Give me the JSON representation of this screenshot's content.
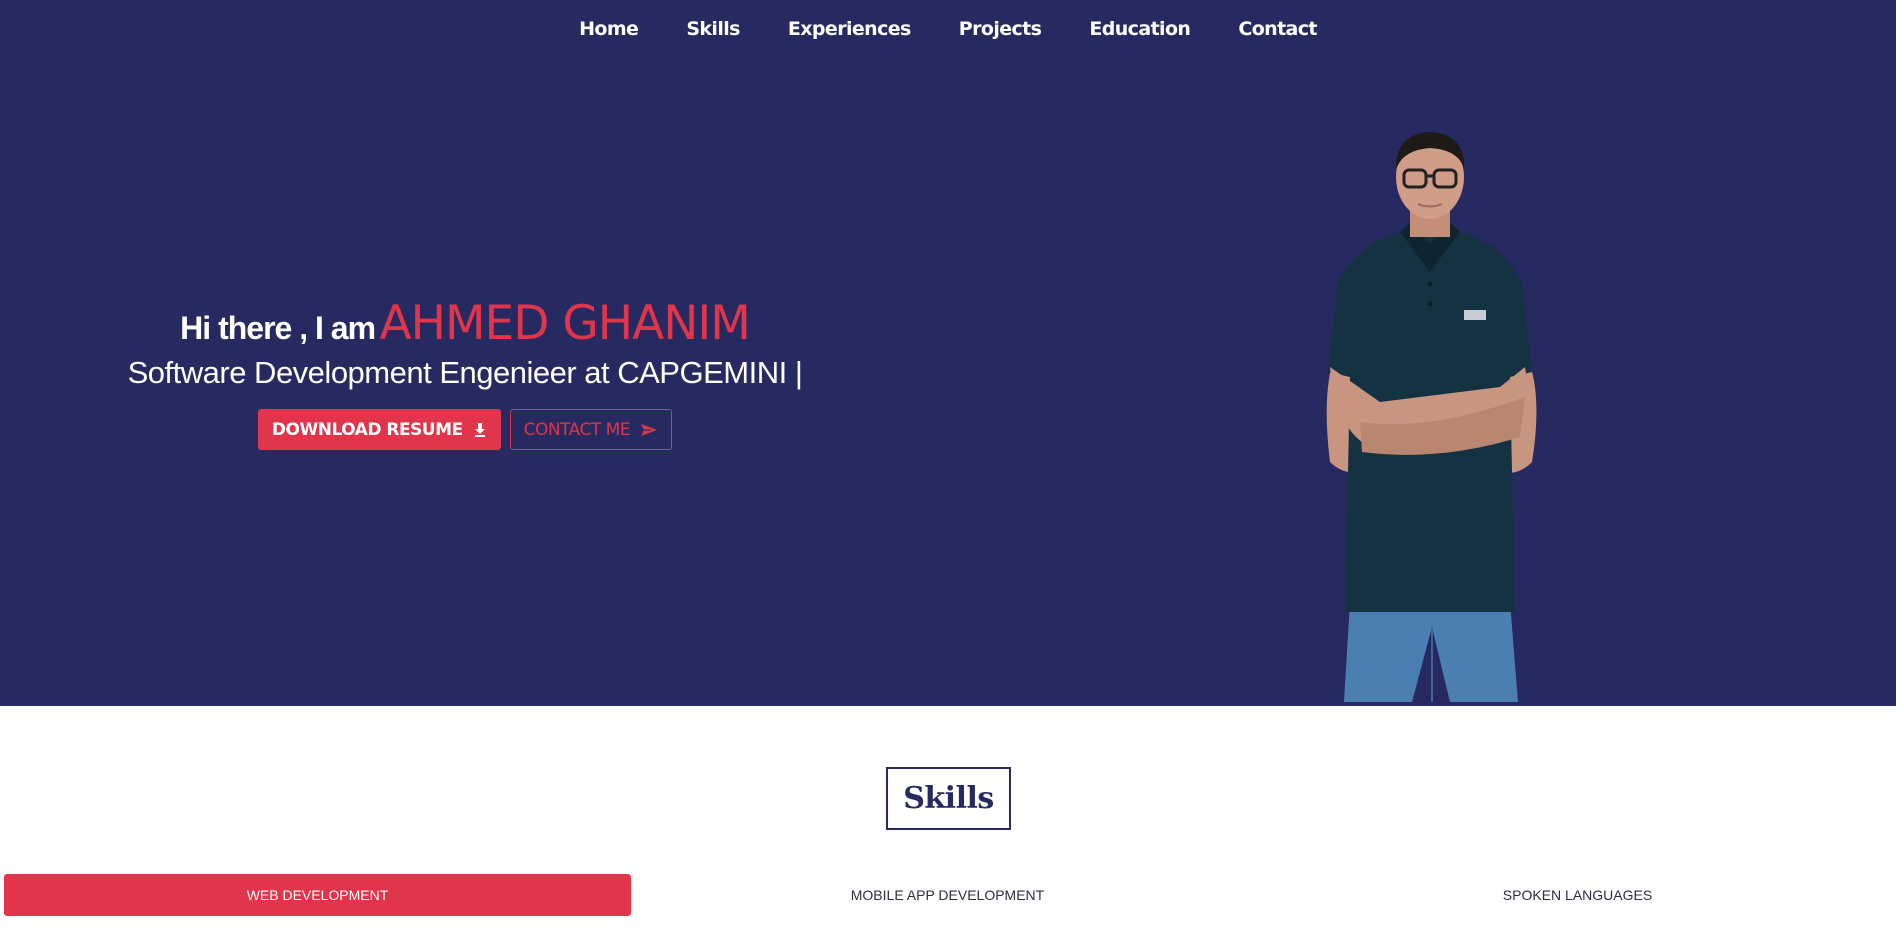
{
  "nav": {
    "items": [
      "Home",
      "Skills",
      "Experiences",
      "Projects",
      "Education",
      "Contact"
    ]
  },
  "hero": {
    "greeting": "Hi there , I am",
    "name": "AHMED GHANIM",
    "subtitle": "Software Development Engenieer at CAPGEMINI |",
    "download_label": "DOWNLOAD RESUME",
    "contact_label": "CONTACT ME",
    "download_icon": "download-icon",
    "contact_icon": "send-icon"
  },
  "skills": {
    "title": "Skills",
    "tabs": [
      "WEB DEVELOPMENT",
      "MOBILE APP DEVELOPMENT",
      "SPOKEN LANGUAGES"
    ],
    "active_tab": "WEB DEVELOPMENT"
  },
  "colors": {
    "primary": "#272a60",
    "accent": "#e0354a",
    "background": "#ffffff"
  }
}
